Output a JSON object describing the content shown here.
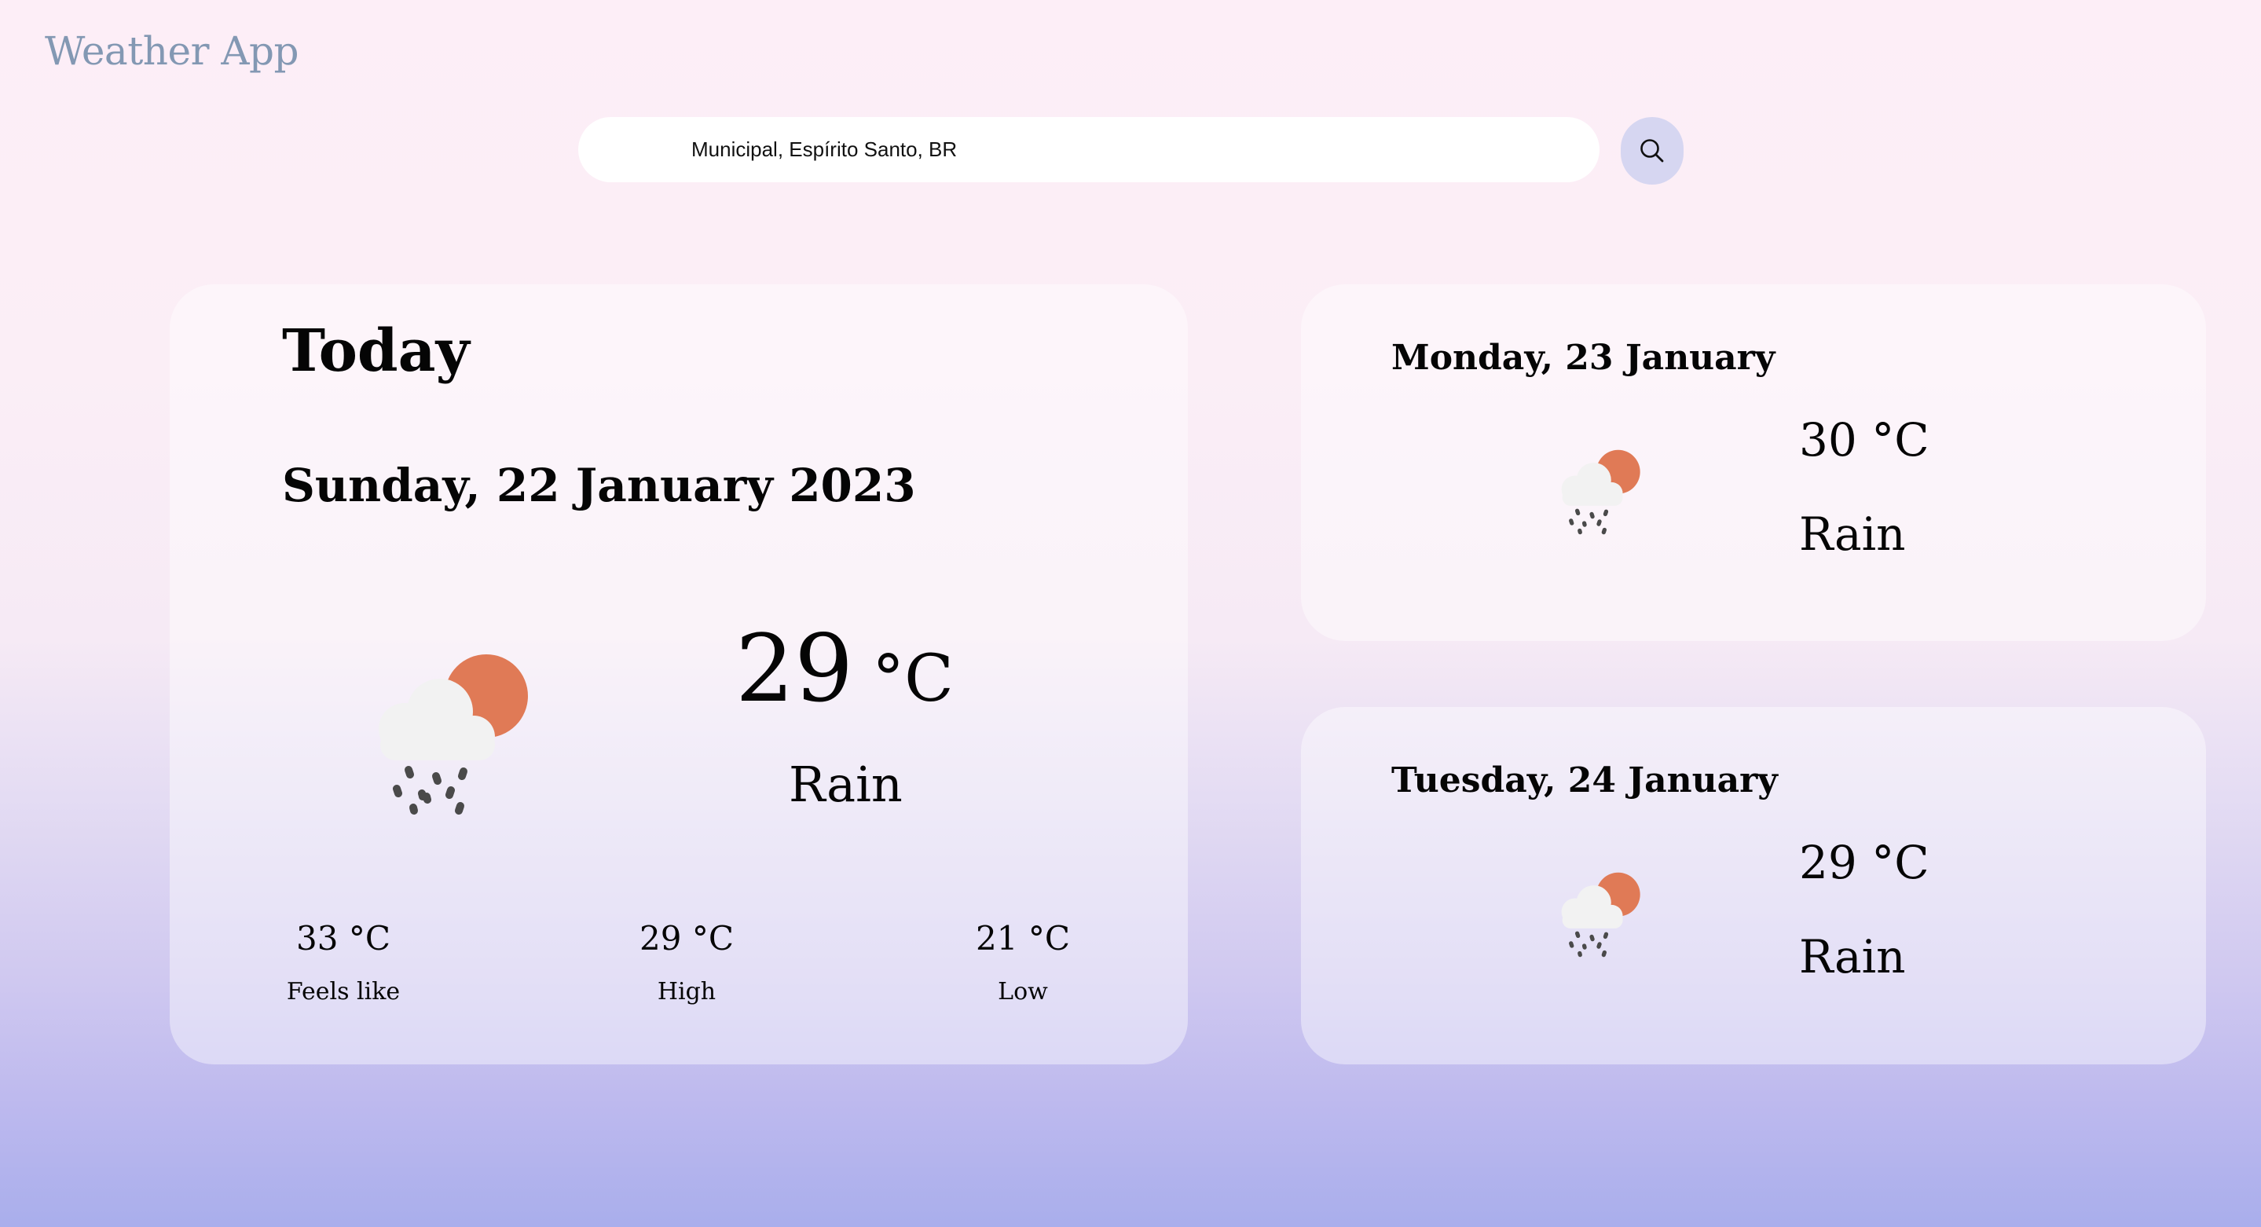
{
  "app": {
    "title": "Weather App"
  },
  "search": {
    "value": "Municipal, Espírito Santo, BR",
    "button_icon": "search-icon"
  },
  "today": {
    "heading": "Today",
    "date": "Sunday, 22 January 2023",
    "temperature": "29",
    "unit": "°C",
    "condition": "Rain",
    "icon": "cloud-sun-rain-icon",
    "stats": [
      {
        "value": "33 °C",
        "label": "Feels like"
      },
      {
        "value": "29 °C",
        "label": "High"
      },
      {
        "value": "21 °C",
        "label": "Low"
      }
    ]
  },
  "forecast": [
    {
      "date": "Monday, 23 January",
      "temperature": "30 °C",
      "condition": "Rain",
      "icon": "cloud-sun-rain-icon"
    },
    {
      "date": "Tuesday, 24 January",
      "temperature": "29 °C",
      "condition": "Rain",
      "icon": "cloud-sun-rain-icon"
    }
  ],
  "colors": {
    "title": "#8398b3",
    "sun": "#e07a56",
    "cloud": "#f2f2f2",
    "rain": "#4a4a4a",
    "search_button": "#d6d6f1"
  }
}
